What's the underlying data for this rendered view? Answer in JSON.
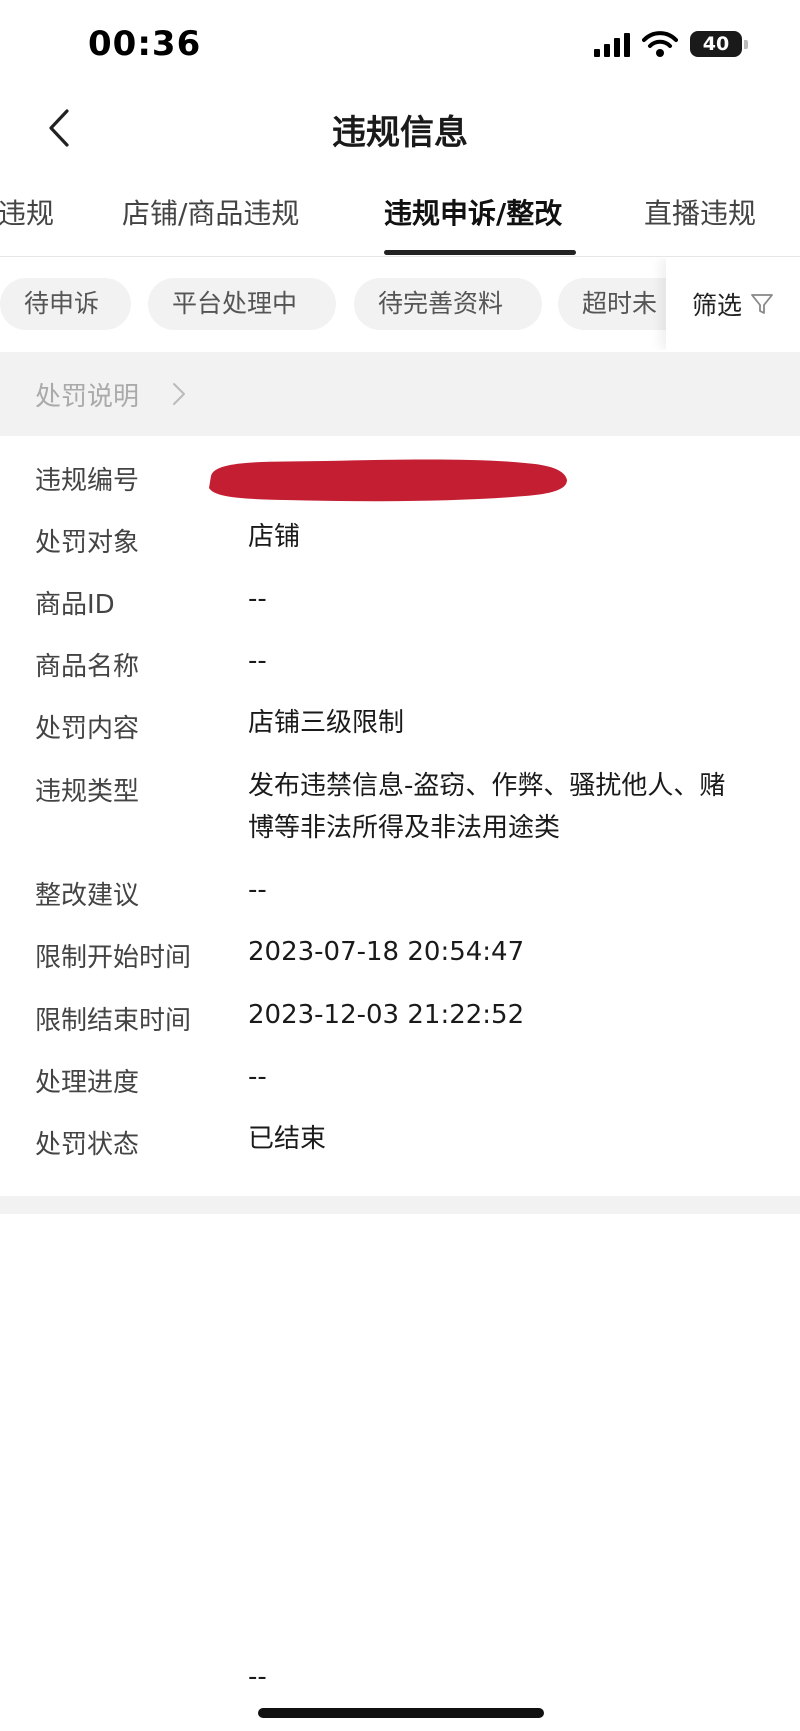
{
  "status_bar": {
    "time": "00:36",
    "battery": "40"
  },
  "nav": {
    "title": "违规信息"
  },
  "tabs": [
    {
      "label": "违规"
    },
    {
      "label": "店铺/商品违规"
    },
    {
      "label": "违规申诉/整改"
    },
    {
      "label": "直播违规"
    }
  ],
  "active_tab": "违规申诉/整改",
  "chips": [
    {
      "label": "待申诉"
    },
    {
      "label": "平台处理中"
    },
    {
      "label": "待完善资料"
    },
    {
      "label": "超时未"
    }
  ],
  "filter": {
    "label": "筛选"
  },
  "explain": {
    "label": "处罚说明"
  },
  "details": [
    {
      "label": "违规编号",
      "value": ""
    },
    {
      "label": "处罚对象",
      "value": "店铺"
    },
    {
      "label": "商品ID",
      "value": "--"
    },
    {
      "label": "商品名称",
      "value": "--"
    },
    {
      "label": "处罚内容",
      "value": "店铺三级限制"
    },
    {
      "label": "违规类型",
      "value": "发布违禁信息-盗窃、作弊、骚扰他人、赌博等非法所得及非法用途类"
    },
    {
      "label": "整改建议",
      "value": "--"
    },
    {
      "label": "限制开始时间",
      "value": "2023-07-18 20:54:47"
    },
    {
      "label": "限制结束时间",
      "value": "2023-12-03 21:22:52"
    },
    {
      "label": "处理进度",
      "value": "--"
    },
    {
      "label": "处罚状态",
      "value": "已结束"
    }
  ],
  "bottom": {
    "dash": "--"
  },
  "colors": {
    "redaction": "#c41e33",
    "chip_bg": "#f2f2f2",
    "section_bg": "#f2f2f2"
  }
}
